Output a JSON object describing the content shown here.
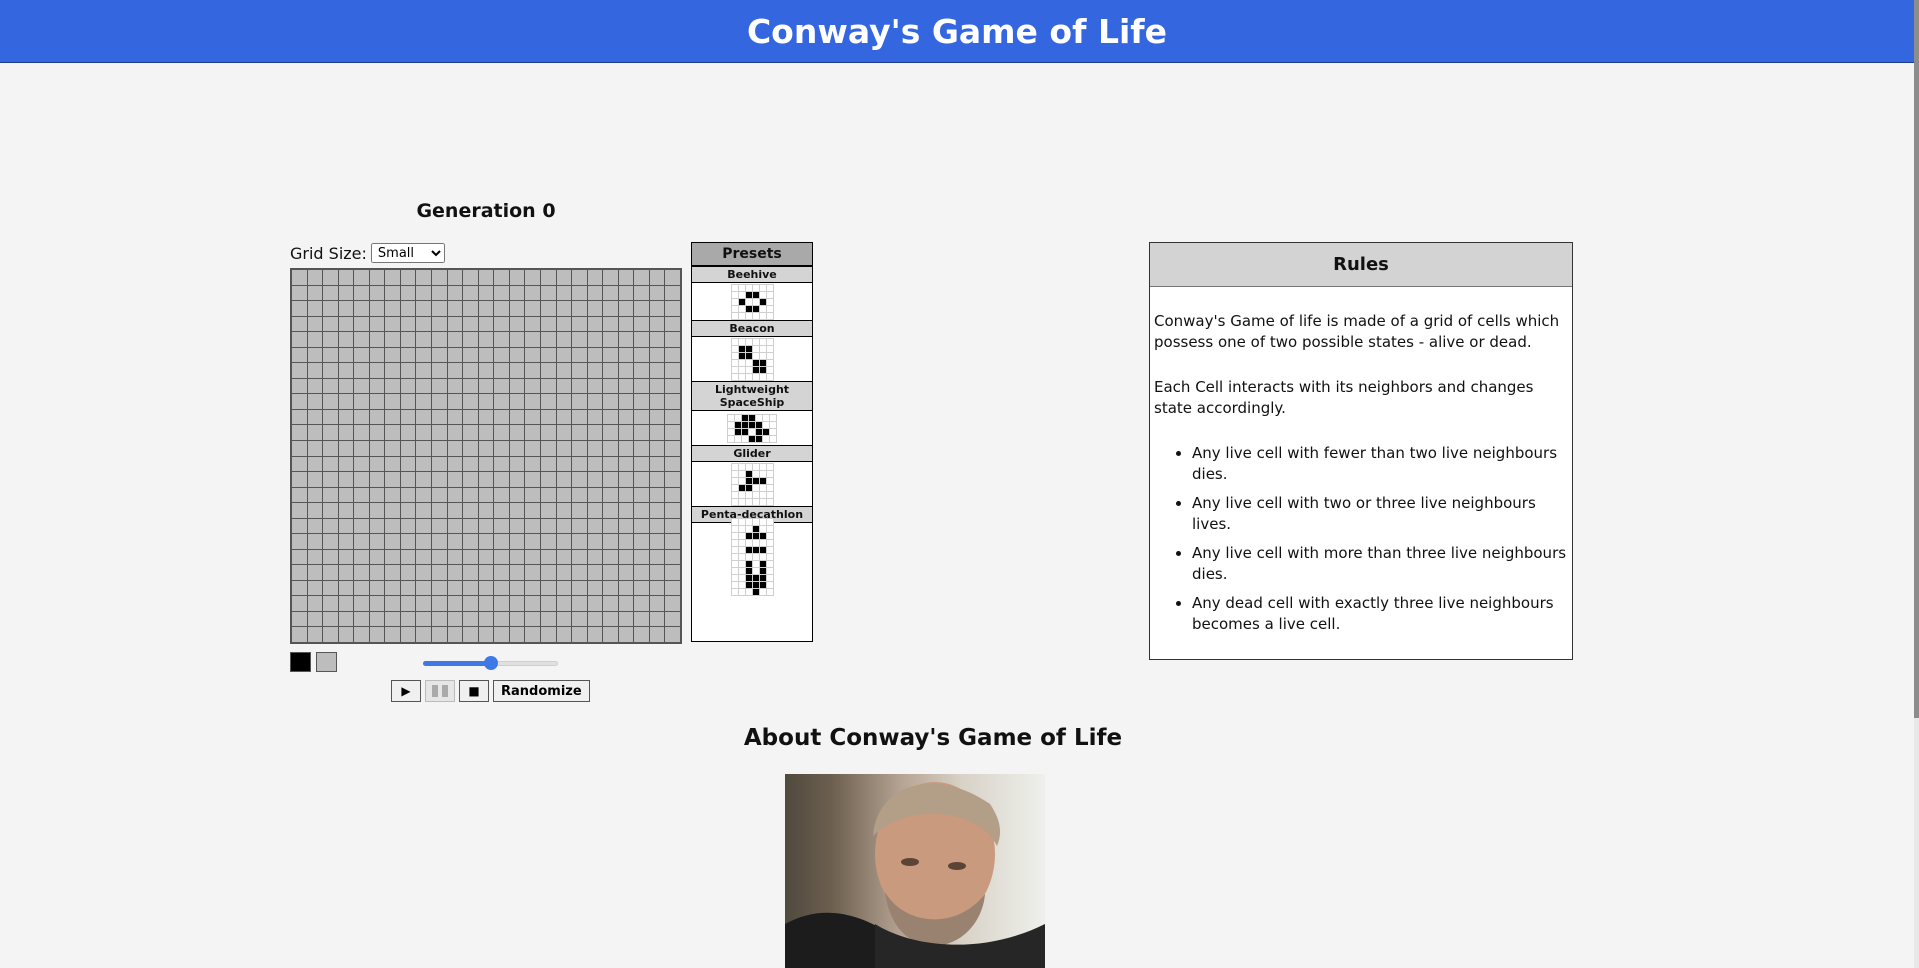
{
  "header": {
    "title": "Conway's Game of Life"
  },
  "board": {
    "generation_label": "Generation 0",
    "grid_size_label": "Grid Size:",
    "grid_size_selected": "Small",
    "grid_size_options": [
      "Small"
    ],
    "columns": 25,
    "rows": 24,
    "alive_cells": [],
    "speed_level": 0.5,
    "colors": {
      "alive": "#000000",
      "dead": "#bdbdbd"
    }
  },
  "controls": {
    "play_icon": "▶",
    "stop_icon": "■",
    "randomize_label": "Randomize"
  },
  "presets": {
    "title": "Presets",
    "items": [
      {
        "name": "Beehive",
        "cols": 6,
        "rows": 5,
        "cells": [
          [
            1,
            2
          ],
          [
            1,
            3
          ],
          [
            2,
            1
          ],
          [
            2,
            4
          ],
          [
            3,
            2
          ],
          [
            3,
            3
          ]
        ]
      },
      {
        "name": "Beacon",
        "cols": 6,
        "rows": 6,
        "cells": [
          [
            1,
            1
          ],
          [
            1,
            2
          ],
          [
            2,
            1
          ],
          [
            2,
            2
          ],
          [
            3,
            3
          ],
          [
            3,
            4
          ],
          [
            4,
            3
          ],
          [
            4,
            4
          ]
        ]
      },
      {
        "name": "Lightweight SpaceShip",
        "cols": 7,
        "rows": 4,
        "cells": [
          [
            0,
            2
          ],
          [
            0,
            3
          ],
          [
            1,
            1
          ],
          [
            1,
            2
          ],
          [
            1,
            3
          ],
          [
            1,
            4
          ],
          [
            2,
            1
          ],
          [
            2,
            2
          ],
          [
            2,
            4
          ],
          [
            2,
            5
          ],
          [
            3,
            3
          ],
          [
            3,
            4
          ]
        ]
      },
      {
        "name": "Glider",
        "cols": 6,
        "rows": 6,
        "cells": [
          [
            1,
            2
          ],
          [
            2,
            2
          ],
          [
            2,
            3
          ],
          [
            2,
            4
          ],
          [
            3,
            1
          ],
          [
            3,
            2
          ]
        ]
      },
      {
        "name": "Penta-decathlon",
        "cols": 6,
        "rows": 11,
        "cells": [
          [
            1,
            3
          ],
          [
            2,
            2
          ],
          [
            2,
            3
          ],
          [
            2,
            4
          ],
          [
            4,
            2
          ],
          [
            4,
            3
          ],
          [
            4,
            4
          ],
          [
            6,
            2
          ],
          [
            6,
            4
          ],
          [
            7,
            2
          ],
          [
            7,
            4
          ],
          [
            8,
            2
          ],
          [
            8,
            3
          ],
          [
            8,
            4
          ],
          [
            9,
            2
          ],
          [
            9,
            3
          ],
          [
            9,
            4
          ],
          [
            10,
            3
          ]
        ]
      }
    ]
  },
  "rules": {
    "title": "Rules",
    "paragraphs": [
      "Conway's Game of life is made of a grid of cells which possess one of two possible states - alive or dead.",
      "Each Cell interacts with its neighbors and changes state accordingly."
    ],
    "items": [
      "Any live cell with fewer than two live neighbours dies.",
      "Any live cell with two or three live neighbours lives.",
      "Any live cell with more than three live neighbours dies.",
      "Any dead cell with exactly three live neighbours becomes a live cell."
    ]
  },
  "about": {
    "title": "About Conway's Game of Life"
  }
}
